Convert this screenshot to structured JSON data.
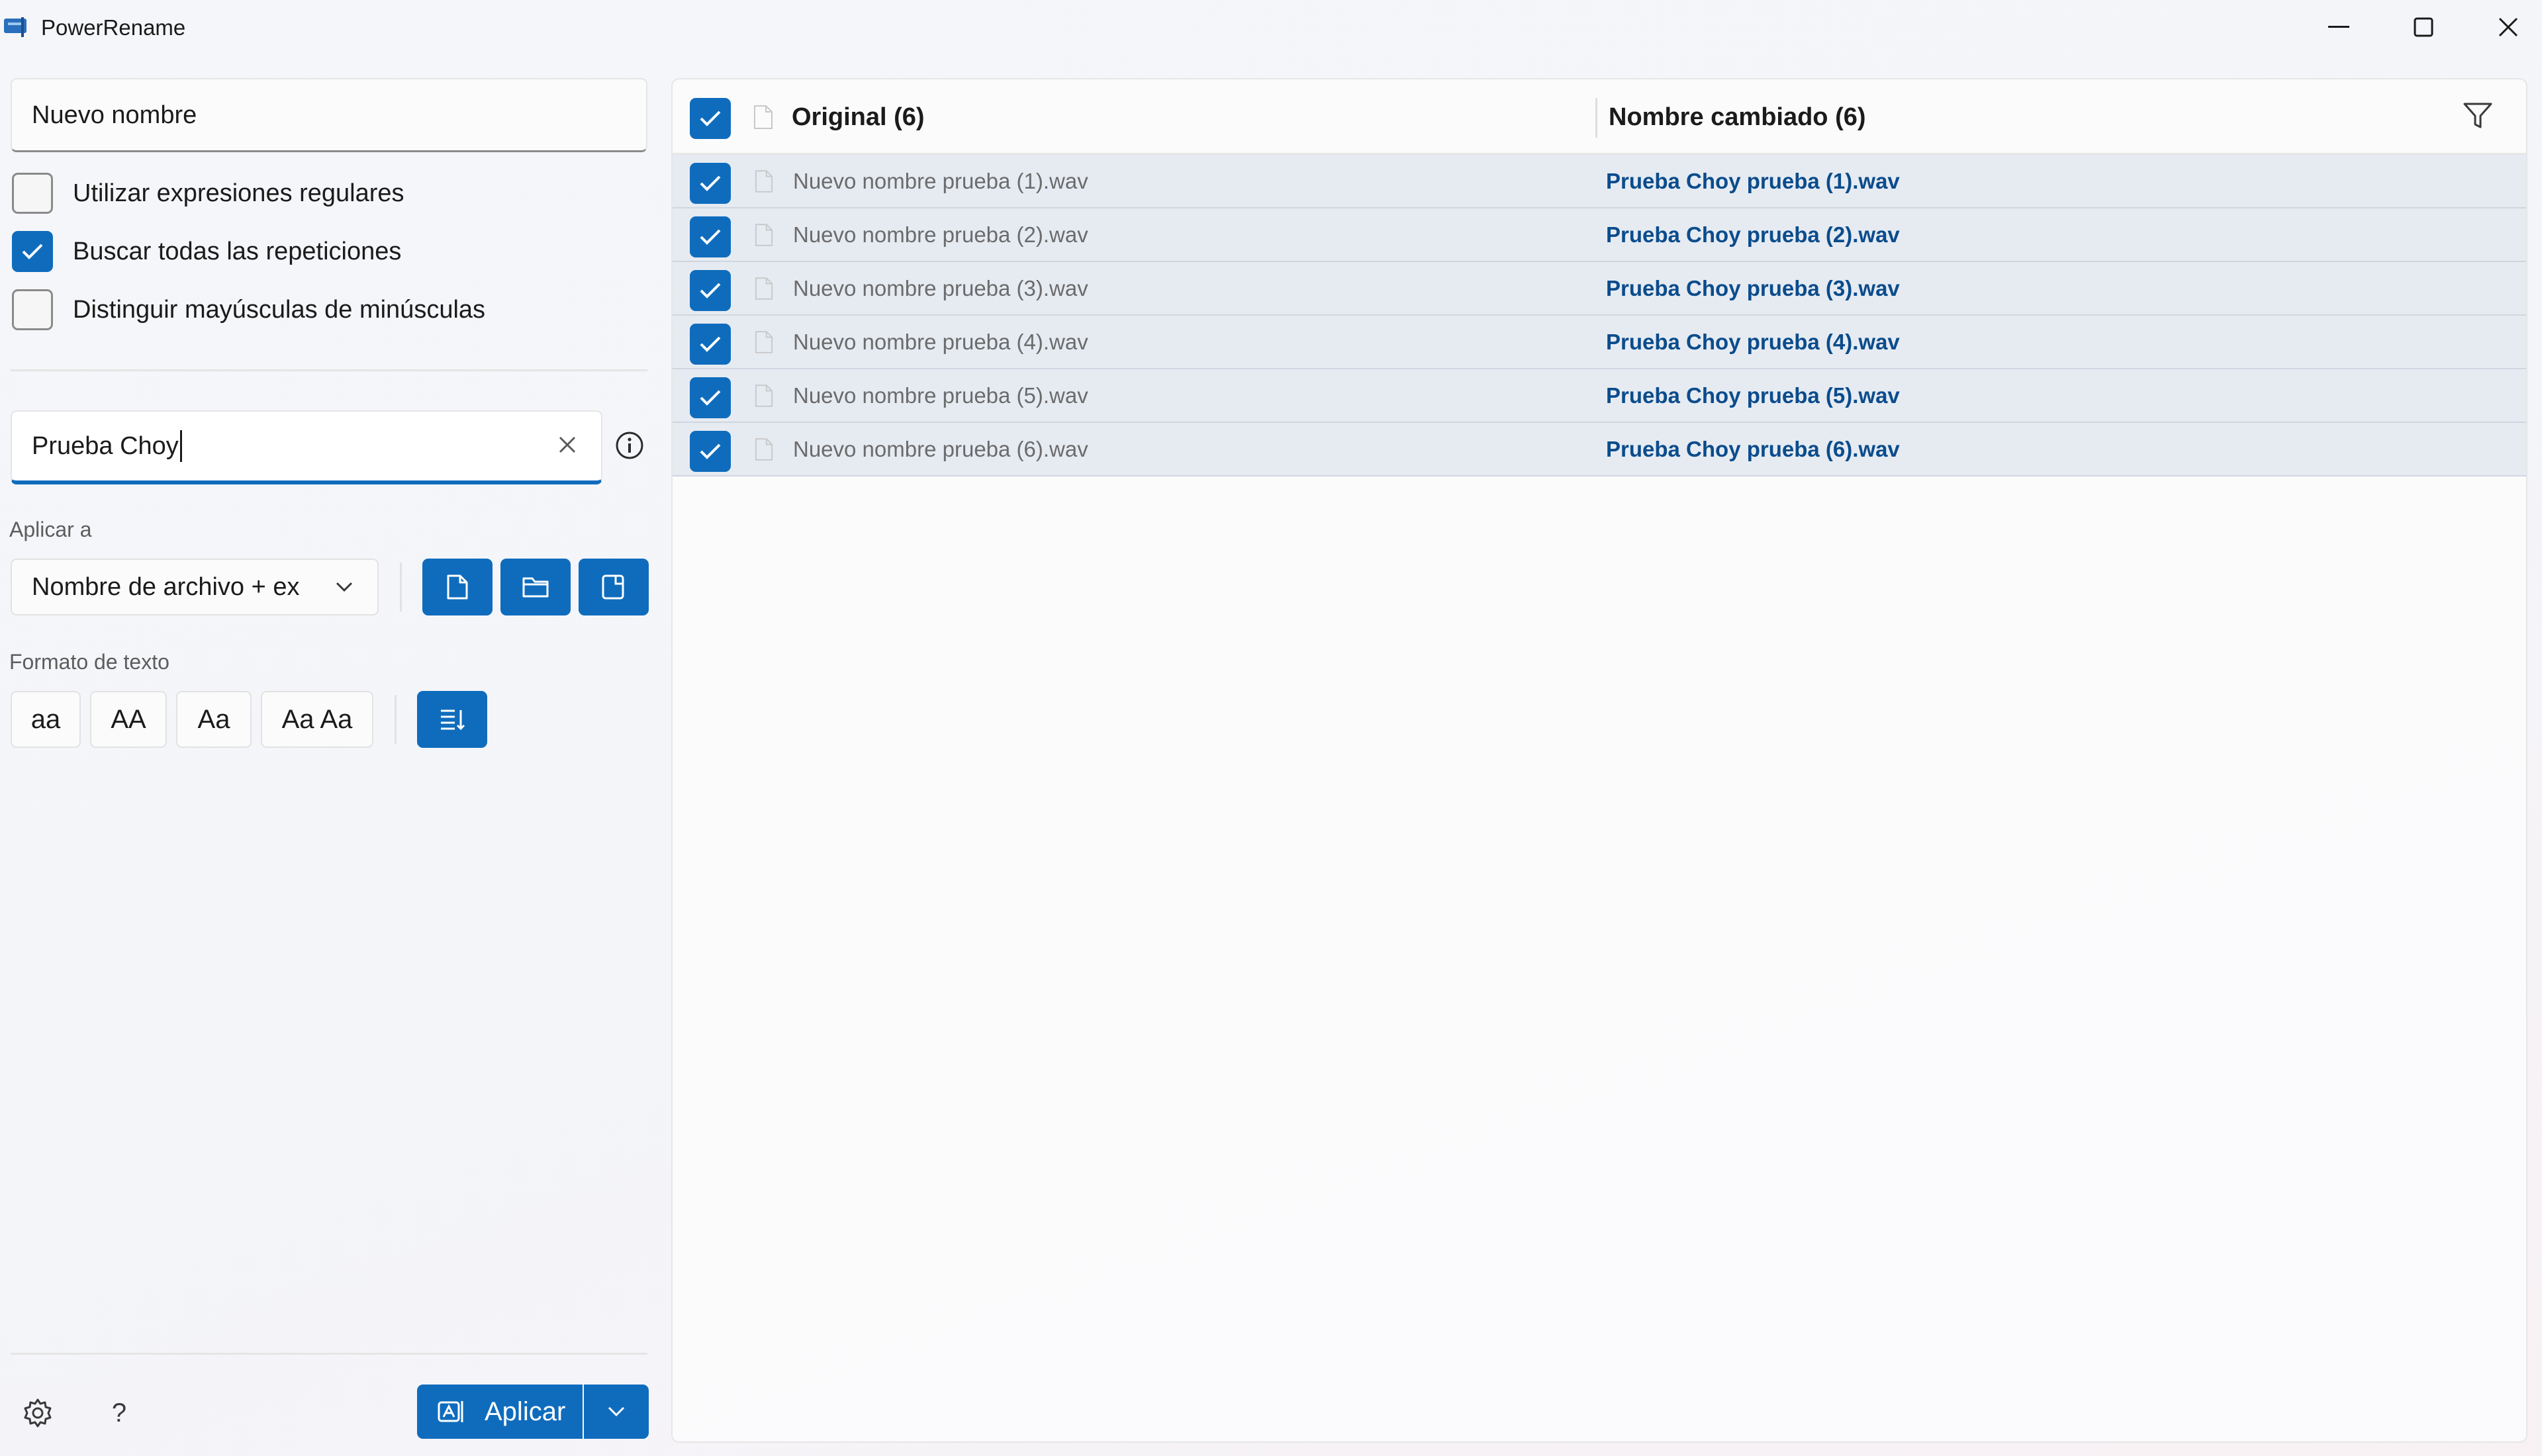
{
  "window": {
    "title": "PowerRename"
  },
  "search": {
    "value": "Nuevo nombre"
  },
  "options": [
    {
      "label": "Utilizar expresiones regulares",
      "checked": false
    },
    {
      "label": "Buscar todas las repeticiones",
      "checked": true
    },
    {
      "label": "Distinguir mayúsculas de minúsculas",
      "checked": false
    }
  ],
  "replace": {
    "value": "Prueba Choy"
  },
  "apply_to": {
    "label": "Aplicar a",
    "selected": "Nombre de archivo + ex"
  },
  "text_format": {
    "label": "Formato de texto",
    "buttons": [
      "aa",
      "AA",
      "Aa",
      "Aa Aa"
    ]
  },
  "apply_button": {
    "label": "Aplicar"
  },
  "help": {
    "label": "?"
  },
  "list": {
    "header_original": "Original (6)",
    "header_renamed": "Nombre cambiado (6)",
    "rows": [
      {
        "original": "Nuevo nombre prueba (1).wav",
        "renamed": "Prueba Choy prueba (1).wav",
        "checked": true
      },
      {
        "original": "Nuevo nombre prueba (2).wav",
        "renamed": "Prueba Choy prueba (2).wav",
        "checked": true
      },
      {
        "original": "Nuevo nombre prueba (3).wav",
        "renamed": "Prueba Choy prueba (3).wav",
        "checked": true
      },
      {
        "original": "Nuevo nombre prueba (4).wav",
        "renamed": "Prueba Choy prueba (4).wav",
        "checked": true
      },
      {
        "original": "Nuevo nombre prueba (5).wav",
        "renamed": "Prueba Choy prueba (5).wav",
        "checked": true
      },
      {
        "original": "Nuevo nombre prueba (6).wav",
        "renamed": "Prueba Choy prueba (6).wav",
        "checked": true
      }
    ]
  },
  "colors": {
    "accent": "#0f6cbd",
    "row_bg": "#e6ebf2",
    "renamed_text": "#0b4c8c"
  },
  "icons": {
    "app": "powerrename-icon",
    "minimize": "minimize-icon",
    "maximize": "maximize-icon",
    "close": "close-icon",
    "clear": "clear-icon",
    "info": "info-icon",
    "chevron": "chevron-down-icon",
    "file": "file-icon",
    "folder": "folder-icon",
    "subfolder": "subfolder-icon",
    "enumerate": "enumerate-icon",
    "settings": "gear-icon",
    "filter": "filter-icon",
    "rename": "rename-icon"
  }
}
